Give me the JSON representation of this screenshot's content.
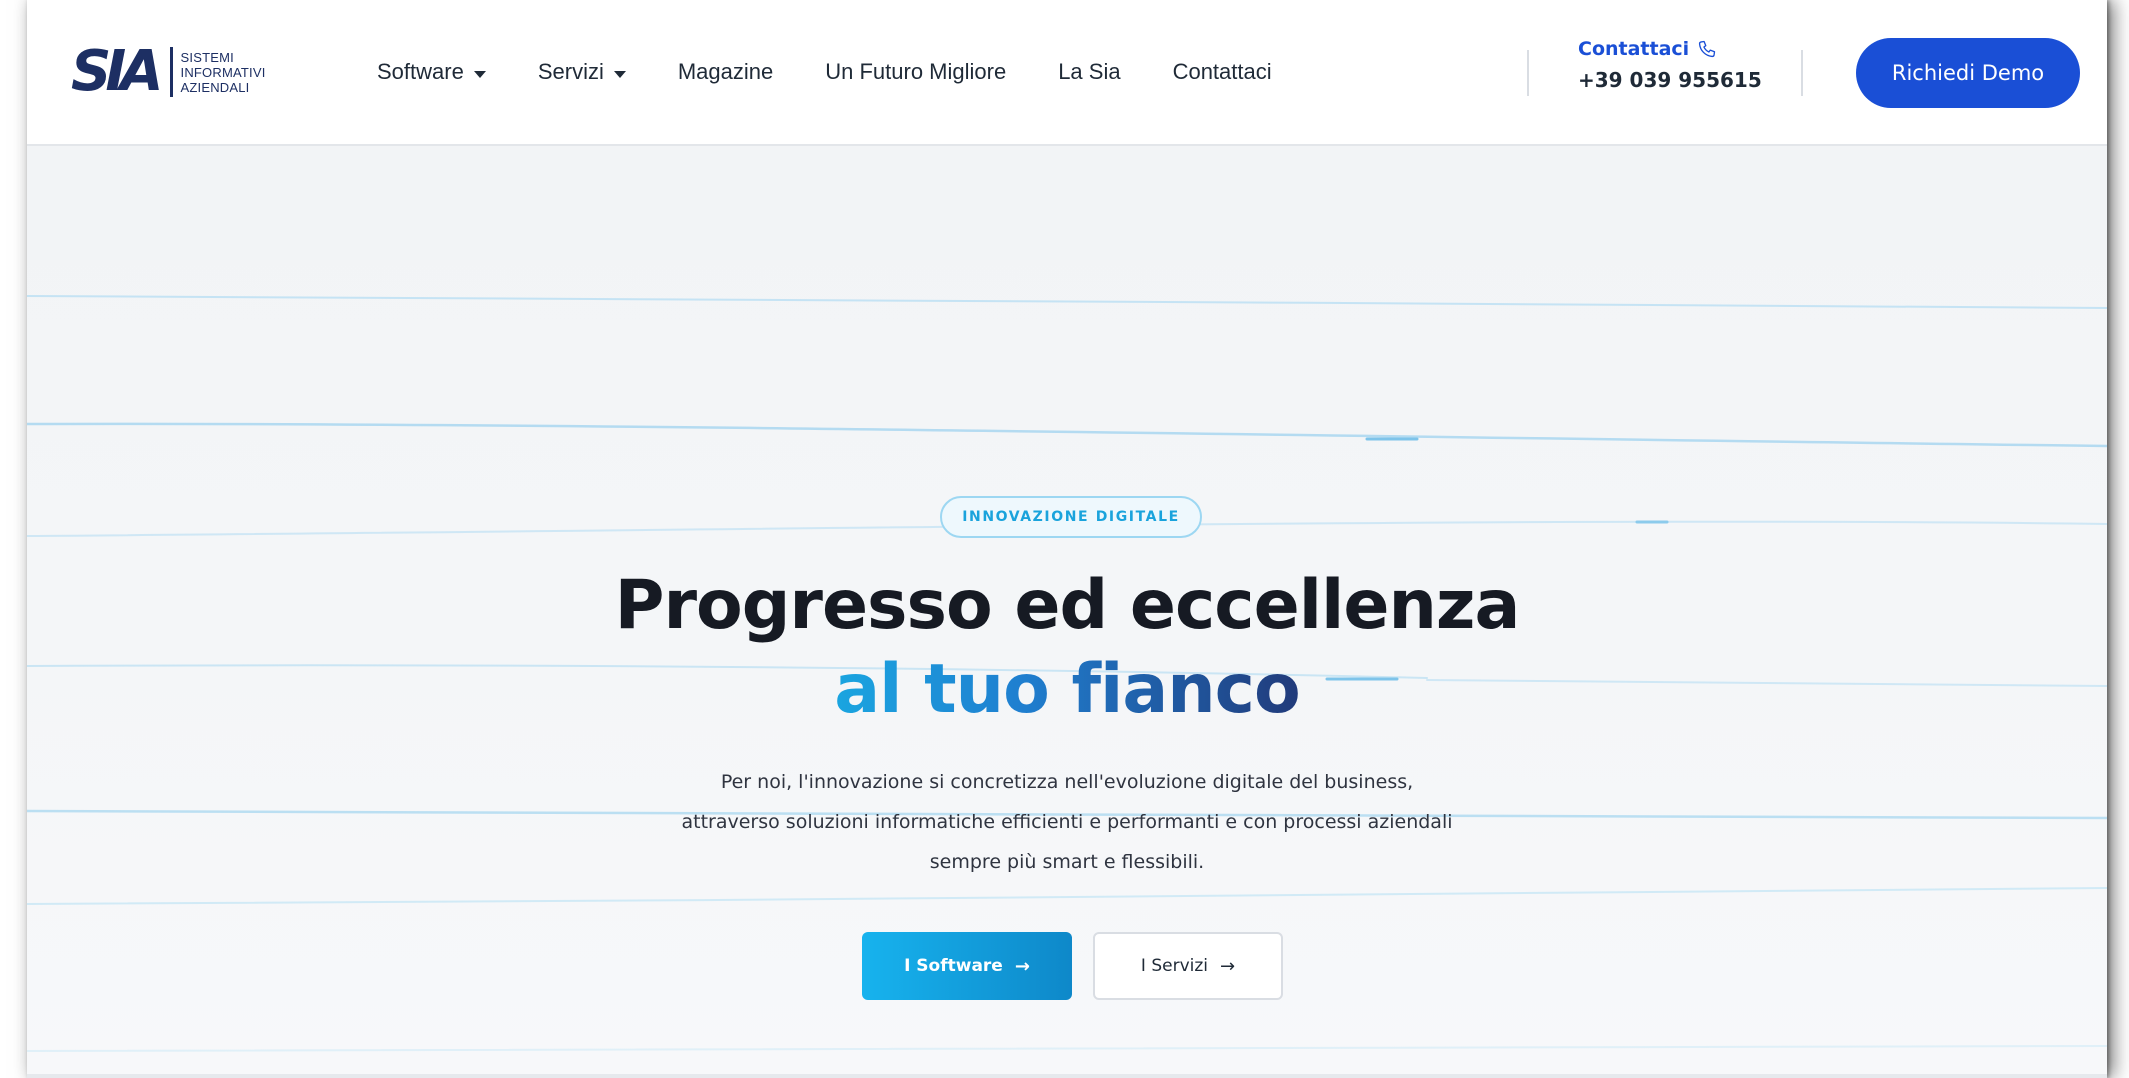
{
  "logo": {
    "mark": "SIA",
    "lines": [
      "SISTEMI",
      "INFORMATIVI",
      "AZIENDALI"
    ]
  },
  "nav": {
    "items": [
      {
        "label": "Software",
        "dropdown": true
      },
      {
        "label": "Servizi",
        "dropdown": true
      },
      {
        "label": "Magazine",
        "dropdown": false
      },
      {
        "label": "Un Futuro Migliore",
        "dropdown": false
      },
      {
        "label": "La Sia",
        "dropdown": false
      },
      {
        "label": "Contattaci",
        "dropdown": false
      }
    ]
  },
  "contact": {
    "label": "Contattaci",
    "icon": "phone-icon",
    "phone": "+39 039 955615"
  },
  "header": {
    "demo_button": "Richiedi Demo"
  },
  "hero": {
    "badge": "INNOVAZIONE DIGITALE",
    "title_line1": "Progresso ed eccellenza",
    "title_line2": "al tuo fianco",
    "description": [
      "Per noi, l'innovazione si concretizza nell'evoluzione digitale del business,",
      "attraverso soluzioni informatiche efficienti e performanti e con processi aziendali",
      "sempre più smart e flessibili."
    ],
    "primary_button": "I Software",
    "secondary_button": "I Servizi",
    "arrow": "→"
  },
  "colors": {
    "brand_blue": "#1a4fd6",
    "accent_cyan": "#1aa5e0",
    "navy": "#213a7a",
    "text_dark": "#161a23"
  }
}
